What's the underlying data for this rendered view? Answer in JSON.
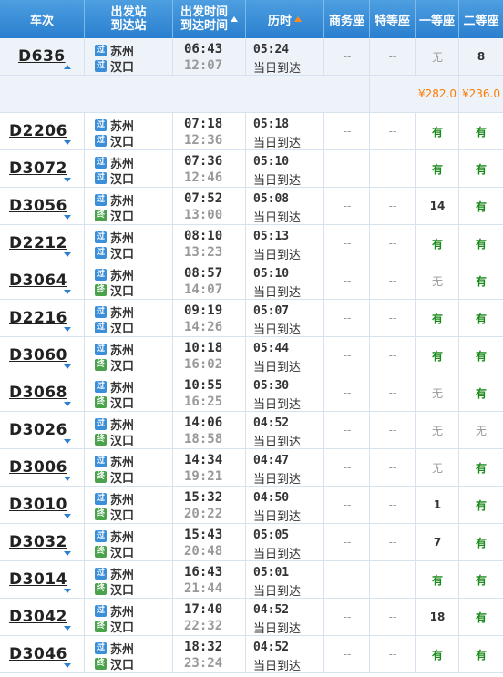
{
  "header": {
    "train": "车次",
    "station_top": "出发站",
    "station_bottom": "到达站",
    "time_top": "出发时间",
    "time_bottom": "到达时间",
    "duration": "历时",
    "business": "商务座",
    "special": "特等座",
    "first": "一等座",
    "second": "二等座"
  },
  "selected_prices": {
    "first": "¥282.0",
    "second": "¥236.0"
  },
  "trains": [
    {
      "no": "D636",
      "from": "苏州",
      "to": "汉口",
      "from_icon": "过",
      "to_icon": "过",
      "dep": "06:43",
      "arr": "12:07",
      "dur": "05:24",
      "arrive_note": "当日到达",
      "business": "--",
      "special": "--",
      "first": "无",
      "second": "8"
    },
    {
      "no": "D2206",
      "from": "苏州",
      "to": "汉口",
      "from_icon": "过",
      "to_icon": "过",
      "dep": "07:18",
      "arr": "12:36",
      "dur": "05:18",
      "arrive_note": "当日到达",
      "business": "--",
      "special": "--",
      "first": "有",
      "second": "有"
    },
    {
      "no": "D3072",
      "from": "苏州",
      "to": "汉口",
      "from_icon": "过",
      "to_icon": "过",
      "dep": "07:36",
      "arr": "12:46",
      "dur": "05:10",
      "arrive_note": "当日到达",
      "business": "--",
      "special": "--",
      "first": "有",
      "second": "有"
    },
    {
      "no": "D3056",
      "from": "苏州",
      "to": "汉口",
      "from_icon": "过",
      "to_icon": "终",
      "dep": "07:52",
      "arr": "13:00",
      "dur": "05:08",
      "arrive_note": "当日到达",
      "business": "--",
      "special": "--",
      "first": "14",
      "second": "有"
    },
    {
      "no": "D2212",
      "from": "苏州",
      "to": "汉口",
      "from_icon": "过",
      "to_icon": "过",
      "dep": "08:10",
      "arr": "13:23",
      "dur": "05:13",
      "arrive_note": "当日到达",
      "business": "--",
      "special": "--",
      "first": "有",
      "second": "有"
    },
    {
      "no": "D3064",
      "from": "苏州",
      "to": "汉口",
      "from_icon": "过",
      "to_icon": "终",
      "dep": "08:57",
      "arr": "14:07",
      "dur": "05:10",
      "arrive_note": "当日到达",
      "business": "--",
      "special": "--",
      "first": "无",
      "second": "有"
    },
    {
      "no": "D2216",
      "from": "苏州",
      "to": "汉口",
      "from_icon": "过",
      "to_icon": "过",
      "dep": "09:19",
      "arr": "14:26",
      "dur": "05:07",
      "arrive_note": "当日到达",
      "business": "--",
      "special": "--",
      "first": "有",
      "second": "有"
    },
    {
      "no": "D3060",
      "from": "苏州",
      "to": "汉口",
      "from_icon": "过",
      "to_icon": "终",
      "dep": "10:18",
      "arr": "16:02",
      "dur": "05:44",
      "arrive_note": "当日到达",
      "business": "--",
      "special": "--",
      "first": "有",
      "second": "有"
    },
    {
      "no": "D3068",
      "from": "苏州",
      "to": "汉口",
      "from_icon": "过",
      "to_icon": "终",
      "dep": "10:55",
      "arr": "16:25",
      "dur": "05:30",
      "arrive_note": "当日到达",
      "business": "--",
      "special": "--",
      "first": "无",
      "second": "有"
    },
    {
      "no": "D3026",
      "from": "苏州",
      "to": "汉口",
      "from_icon": "过",
      "to_icon": "终",
      "dep": "14:06",
      "arr": "18:58",
      "dur": "04:52",
      "arrive_note": "当日到达",
      "business": "--",
      "special": "--",
      "first": "无",
      "second": "无"
    },
    {
      "no": "D3006",
      "from": "苏州",
      "to": "汉口",
      "from_icon": "过",
      "to_icon": "终",
      "dep": "14:34",
      "arr": "19:21",
      "dur": "04:47",
      "arrive_note": "当日到达",
      "business": "--",
      "special": "--",
      "first": "无",
      "second": "有"
    },
    {
      "no": "D3010",
      "from": "苏州",
      "to": "汉口",
      "from_icon": "过",
      "to_icon": "终",
      "dep": "15:32",
      "arr": "20:22",
      "dur": "04:50",
      "arrive_note": "当日到达",
      "business": "--",
      "special": "--",
      "first": "1",
      "second": "有"
    },
    {
      "no": "D3032",
      "from": "苏州",
      "to": "汉口",
      "from_icon": "过",
      "to_icon": "终",
      "dep": "15:43",
      "arr": "20:48",
      "dur": "05:05",
      "arrive_note": "当日到达",
      "business": "--",
      "special": "--",
      "first": "7",
      "second": "有"
    },
    {
      "no": "D3014",
      "from": "苏州",
      "to": "汉口",
      "from_icon": "过",
      "to_icon": "终",
      "dep": "16:43",
      "arr": "21:44",
      "dur": "05:01",
      "arrive_note": "当日到达",
      "business": "--",
      "special": "--",
      "first": "有",
      "second": "有"
    },
    {
      "no": "D3042",
      "from": "苏州",
      "to": "汉口",
      "from_icon": "过",
      "to_icon": "终",
      "dep": "17:40",
      "arr": "22:32",
      "dur": "04:52",
      "arrive_note": "当日到达",
      "business": "--",
      "special": "--",
      "first": "18",
      "second": "有"
    },
    {
      "no": "D3046",
      "from": "苏州",
      "to": "汉口",
      "from_icon": "过",
      "to_icon": "终",
      "dep": "18:32",
      "arr": "23:24",
      "dur": "04:52",
      "arrive_note": "当日到达",
      "business": "--",
      "special": "--",
      "first": "有",
      "second": "有"
    }
  ]
}
